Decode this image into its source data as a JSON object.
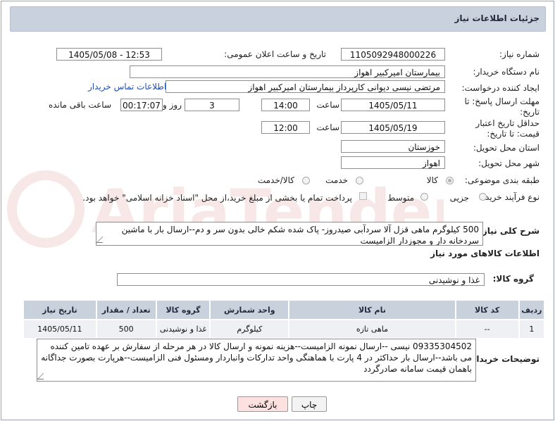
{
  "header": {
    "title": "جزئیات اطلاعات نیاز"
  },
  "form": {
    "need_number_label": "شماره نیاز:",
    "need_number": "1105092948000226",
    "announce_label": "تاریخ و ساعت اعلان عمومی:",
    "announce_value": "1405/05/08 - 12:53",
    "buyer_label": "نام دستگاه خریدار:",
    "buyer_value": "بیمارستان امیرکبیر اهواز",
    "creator_label": "ایجاد کننده درخواست:",
    "creator_value": "مرتضی نیسی دیوانی کارپرداز بیمارستان امیرکبیر اهواز",
    "contact_link": "اطلاعات تماس خریدار",
    "deadline_label": "مهلت ارسال پاسخ: تا تاریخ:",
    "deadline_date": "1405/05/11",
    "time_label": "ساعت",
    "deadline_time": "14:00",
    "days_value": "3",
    "days_label": "روز و",
    "remaining_time": "00:17:07",
    "remaining_label": "ساعت باقی مانده",
    "validity_label": "حداقل تاریخ اعتبار قیمت: تا تاریخ:",
    "validity_date": "1405/05/19",
    "validity_time": "12:00",
    "province_label": "استان محل تحویل:",
    "province_value": "خوزستان",
    "city_label": "شهر محل تحویل:",
    "city_value": "اهواز",
    "category_label": "طبقه بندی موضوعی:",
    "category_options": [
      "کالا",
      "خدمت",
      "کالا/خدمت"
    ],
    "category_selected": "کالا",
    "process_label": "نوع فرآیند خرید :",
    "process_options": [
      "جزیی",
      "متوسط"
    ],
    "process_selected": "جزیی",
    "payment_note": "پرداخت تمام یا بخشی از مبلغ خرید،از محل \"اسناد خزانه اسلامی\" خواهد بود.",
    "description_label": "شرح کلی نیاز:",
    "description_value": "500 کیلوگرم ماهی قزل آلا سردآبی صیدروز- پاک شده شکم خالی بدون سر و دم--ارسال بار با ماشین سردخانه دار و مجوزدار الزامیست"
  },
  "goods": {
    "section_title": "اطلاعات کالاهای مورد نیاز",
    "group_label": "گروه کالا:",
    "group_value": "غذا و نوشیدنی",
    "columns": [
      "ردیف",
      "کد کالا",
      "نام کالا",
      "واحد شمارش",
      "گروه کالا",
      "تعداد / مقدار",
      "تاریخ نیاز"
    ],
    "rows": [
      {
        "index": "1",
        "code": "--",
        "name": "ماهی تازه",
        "unit": "کیلوگرم",
        "group": "غذا و نوشیدنی",
        "qty": "500",
        "date": "1405/05/11"
      }
    ]
  },
  "buyer_notes": {
    "label": "توضیحات خریدار:",
    "text": "09335304502 نیسی --ارسال نمونه الزامیست--هزینه نمونه و ارسال کالا در هر مرحله از سفارش بر عهده تامین کننده می باشد--ارسال بار حداکثر در 4 پارت با هماهنگی واحد تدارکات وانباردار ومسئول فنی الزامیست--هرپارت بصورت جداگانه باهمان قیمت سامانه صادرگردد"
  },
  "buttons": {
    "print": "چاپ",
    "back": "بازگشت"
  },
  "watermark": {
    "text": "AriaTender.net"
  }
}
